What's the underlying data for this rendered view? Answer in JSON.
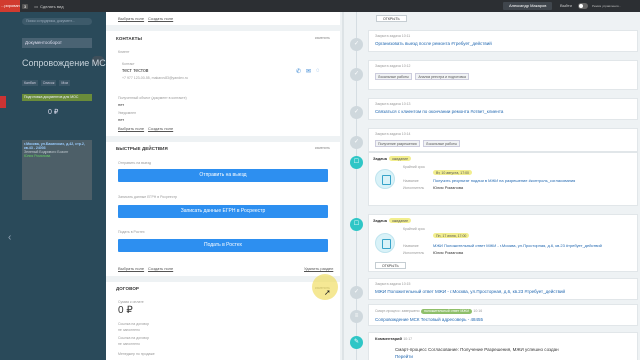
{
  "topbar": {
    "left_label": "...рирование",
    "count": "3",
    "open_label": "Сделать вид",
    "user_name": "Александр Макаров",
    "exit_label": "Выйти",
    "mode_label": "Режим управления..."
  },
  "background": {
    "search_placeholder": "Поиск сотрудника, документ...",
    "tab_label": "Документооборот",
    "page_title": "Сопровождение МСК",
    "filters": [
      "Канбан",
      "Список",
      "Мои"
    ],
    "column_label": "Подготовка документов для МОС",
    "column_amount": "0 ₽",
    "card": {
      "address": "г.Москва, ул.Бакинских, д.42, стр.2, кв.43 - 24003",
      "company": "Зеленый Бодривого Бозонг",
      "status": "Юлия Романова"
    }
  },
  "left": {
    "top_links": {
      "select": "Выбрать поле",
      "create": "Создать поле"
    },
    "contacts": {
      "header": "КОНТАКТЫ",
      "action": "изменить",
      "client_label": "Клиент",
      "contact_label": "Контакт",
      "contact_name": "тест тестов",
      "contact_phone": "+7 977 123-00-55, makarov83@yandex.ru",
      "contact_phone_icon": "phone-icon",
      "field1_label": "Полученный объект (документ в контакте)",
      "field1_value": "нет",
      "field2_label": "Уведомлен",
      "field2_value": "нет",
      "links": {
        "select": "Выбрать поле",
        "create": "Создать поле"
      }
    },
    "actions": {
      "header": "БЫСТРЫЕ ДЕЙСТВИЯ",
      "action": "изменить",
      "btn1_caption": "Отправить на выезд",
      "btn1_label": "Отправить на выезд",
      "btn2_caption": "Записать данные ЕГРН в Росреестр",
      "btn2_label": "Записать данные ЕГРН в Росреестр",
      "btn3_caption": "Подать в Ростех",
      "btn3_label": "Подать в Ростех",
      "links": {
        "select": "Выбрать поле",
        "create": "Создать поле",
        "delete": "Удалить раздел"
      }
    },
    "contract": {
      "header": "ДОГОВОР",
      "action": "изменить",
      "sum_label": "Сумма к оплате",
      "sum_value": "0 ₽",
      "f1_label": "Ссылка на договор",
      "f1_value": "не заполнено",
      "f2_label": "Ссылка на договор",
      "f2_value": "не заполнено",
      "f3_label": "Менеджер по продаже"
    }
  },
  "timeline": {
    "top_button": "ОТКРЫТЬ",
    "items": [
      {
        "small": "Закрыта задача  10:11",
        "link": "Организовать выезд после ремонта #требует_действий"
      },
      {
        "small": "Закрыта задача  10:12",
        "tags": [
          "Локальные работы",
          "Анализ реестра и подготовка"
        ]
      },
      {
        "small": "Закрыта задача  10:13",
        "link": "Связаться с клиентом по окончании ремонта #ответ_клиента"
      },
      {
        "small": "Закрыта задача  10:14",
        "tags": [
          "Получение разрешения",
          "Локальные работы"
        ]
      }
    ],
    "task1": {
      "type": "Задача",
      "badge": "ожидание",
      "deadline_label": "Крайний срок",
      "deadline": "Вт, 10 августа, 17:00",
      "title_label": "Название",
      "title": "Получить результат подачи в МЖИ на разрешение #контроль_согласования",
      "assignee_label": "Исполнитель",
      "assignee": "Юлия Романова"
    },
    "task2": {
      "type": "Задача",
      "badge": "ожидание",
      "deadline_label": "Крайний срок",
      "deadline": "Пн, 17 июня, 17:00",
      "title_label": "Название",
      "title": "МЖИ Положительный ответ МЖИ - г.Москва, ул.Просторная, д.6, кв.23 #требует_действий",
      "assignee_label": "Исполнитель",
      "assignee": "Юлия Романова",
      "button": "ОТКРЫТЬ"
    },
    "closed": {
      "small": "Закрыта задача  10:15",
      "link": "МЖИ Положительный ответ МЖИ - г.Москва, ул.Просторная, д.6, кв.23 #требует_действий"
    },
    "stage": {
      "small": "Смарт-процесс: завершено",
      "badge": "положительный ответ МЖИ",
      "time": "10:16",
      "line": "Сопровождение МСК Тестовый адресоверь - 48455"
    },
    "comment": {
      "type": "Комментарий",
      "time": "10:17",
      "text": "Смарт-процесс Согласование: Получение Разрешения, МЖИ успешно создан",
      "link": "Перейти"
    }
  }
}
